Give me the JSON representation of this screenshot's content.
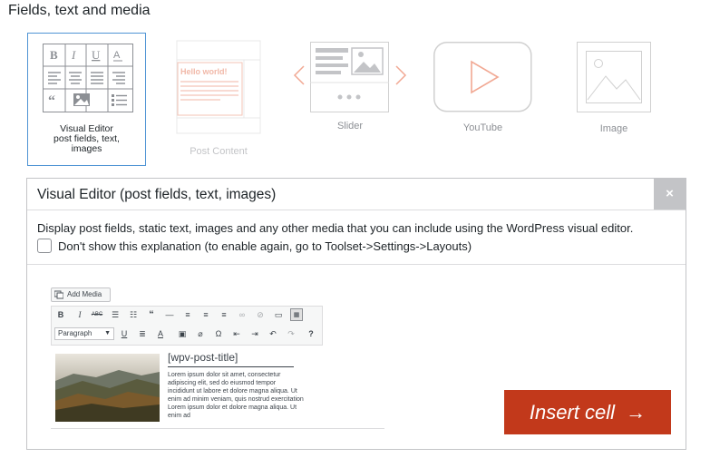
{
  "section": {
    "title": "Fields, text and media"
  },
  "cells": [
    {
      "label_lines": [
        "Visual Editor",
        "post fields, text,",
        "images"
      ]
    },
    {
      "label": "Post Content",
      "preview_text": "Hello world!"
    },
    {
      "label": "Slider"
    },
    {
      "label": "YouTube"
    },
    {
      "label": "Image"
    }
  ],
  "icons": {
    "visual_editor": "visual-editor-icon",
    "post_content": "post-content-icon",
    "slider": "slider-icon",
    "youtube": "youtube-icon",
    "image": "image-icon",
    "close": "close-icon",
    "arrow": "arrow-right-icon"
  },
  "colors": {
    "accent": "#c2391b",
    "selected_border": "#4f94d4",
    "close_bg": "#c3c4c7",
    "icon_gray": "#c3c4c7",
    "icon_red": "#f1b8a8"
  },
  "panel": {
    "title": "Visual Editor (post fields, text, images)",
    "close_label": "×",
    "description": "Display post fields, static text, images and any other media that you can include using the WordPress visual editor.",
    "checkbox_label": "Don't show this explanation (to enable again, go to Toolset->Settings->Layouts)",
    "checkbox_checked": false
  },
  "editor_preview": {
    "add_media": "Add Media",
    "format_select": "Paragraph",
    "toolbar_row1": [
      "B",
      "I",
      "ABC",
      "ul",
      "ol",
      "quote",
      "hr",
      "align-left",
      "align-center",
      "align-right",
      "link",
      "unlink",
      "more",
      "kitchen-sink"
    ],
    "toolbar_row2": [
      "U",
      "justify",
      "A",
      "paste-text",
      "clear",
      "Ω",
      "outdent",
      "indent",
      "undo",
      "redo",
      "?"
    ],
    "title": "[wpv-post-title]",
    "lorem": "Lorem ipsum dolor sit amet, consectetur adipiscing elit, sed do eiusmod tempor incididunt ut labore et dolore magna aliqua. Ut enim ad minim veniam, quis nostrud exercitation Lorem ipsum dolor et dolore magna aliqua. Ut enim ad"
  },
  "insert_button": {
    "label": "Insert cell",
    "arrow": "→"
  }
}
